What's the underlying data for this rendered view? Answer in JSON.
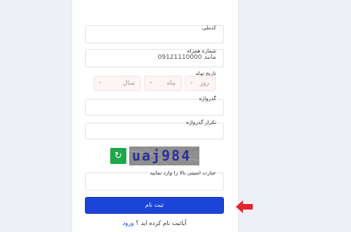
{
  "form": {
    "national_code": {
      "label": "کدملی",
      "value": ""
    },
    "mobile": {
      "label": "شماره همراه",
      "placeholder": "مانند 09121110000"
    },
    "birth_date": {
      "label": "تاریخ تولد",
      "day": "روز",
      "month": "ماه",
      "year": "سال"
    },
    "password": {
      "label": "گذرواژه"
    },
    "password_repeat": {
      "label": "تکرار گذرواژه"
    },
    "captcha": {
      "image_text": "uaj984",
      "refresh_icon": "refresh-icon"
    },
    "security_code": {
      "label": "عبارت امنیتی بالا را وارد نمایید"
    },
    "submit_label": "ثبت نام",
    "login_prompt": "آیاثبت نام کرده اید ؟",
    "login_link": "ورود"
  },
  "colors": {
    "primary": "#1a45d8",
    "refresh": "#1ea84a",
    "arrow": "#e5252a",
    "background": "#eef0f8"
  },
  "icons": {
    "arrow": "arrow-left-icon",
    "chevron": "chevron-down-icon"
  }
}
